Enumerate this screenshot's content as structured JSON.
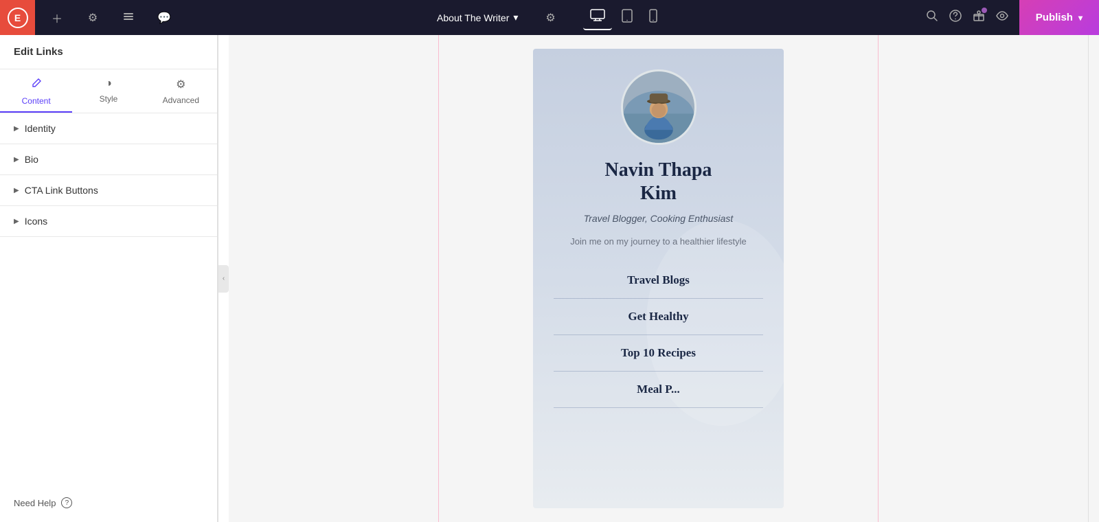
{
  "topnav": {
    "logo_text": "E",
    "page_title": "About The Writer",
    "chevron": "▾",
    "add_label": "+",
    "publish_label": "Publish",
    "publish_chevron": "▾",
    "view_desktop": "🖥",
    "view_tablet": "⬜",
    "view_mobile": "📱",
    "icons": {
      "hamburger": "☰",
      "layers": "⊟",
      "chat": "💬",
      "settings": "⚙",
      "search": "🔍",
      "help": "?",
      "gift": "🎁",
      "eye": "👁"
    }
  },
  "sidebar": {
    "title": "Edit Links",
    "tabs": [
      {
        "id": "content",
        "label": "Content",
        "icon": "✏️",
        "active": true
      },
      {
        "id": "style",
        "label": "Style",
        "icon": "◑"
      },
      {
        "id": "advanced",
        "label": "Advanced",
        "icon": "⚙"
      }
    ],
    "sections": [
      {
        "id": "identity",
        "label": "Identity"
      },
      {
        "id": "bio",
        "label": "Bio"
      },
      {
        "id": "cta-link-buttons",
        "label": "CTA Link Buttons"
      },
      {
        "id": "icons",
        "label": "Icons"
      }
    ],
    "need_help_label": "Need Help",
    "need_help_icon": "?"
  },
  "canvas": {
    "writer": {
      "name_line1": "Navin Thapa",
      "name_line2": "Kim",
      "tagline": "Travel Blogger, Cooking Enthusiast",
      "bio": "Join me on my journey to a healthier lifestyle",
      "cta_buttons": [
        {
          "label": "Travel Blogs"
        },
        {
          "label": "Get Healthy"
        },
        {
          "label": "Top 10 Recipes"
        },
        {
          "label": "Meal P..."
        }
      ]
    }
  },
  "colors": {
    "active_tab": "#5a3ef8",
    "publish_gradient_start": "#d63fb5",
    "publish_gradient_end": "#b83cde",
    "writer_name_color": "#1a2744",
    "bg_top": "#c5cfe0",
    "bg_mid": "#d4dce8"
  }
}
